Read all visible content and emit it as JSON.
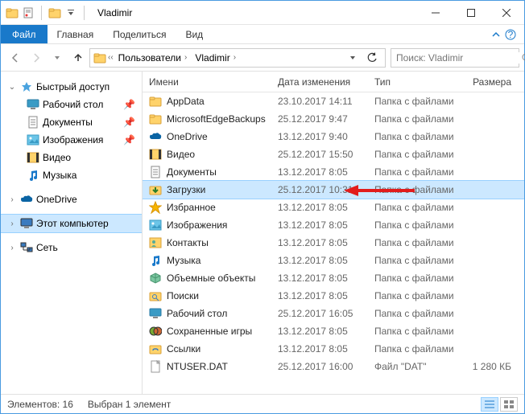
{
  "window": {
    "title": "Vladimir"
  },
  "ribbon": {
    "file": "Файл",
    "tabs": [
      "Главная",
      "Поделиться",
      "Вид"
    ]
  },
  "breadcrumbs": [
    "Пользователи",
    "Vladimir"
  ],
  "search": {
    "placeholder": "Поиск: Vladimir"
  },
  "nav": {
    "quick": {
      "label": "Быстрый доступ",
      "children": [
        {
          "label": "Рабочий стол",
          "icon": "desktop",
          "pin": true
        },
        {
          "label": "Документы",
          "icon": "documents",
          "pin": true
        },
        {
          "label": "Изображения",
          "icon": "pictures",
          "pin": true
        },
        {
          "label": "Видео",
          "icon": "videos",
          "pin": false
        },
        {
          "label": "Музыка",
          "icon": "music",
          "pin": false
        }
      ]
    },
    "onedrive": {
      "label": "OneDrive"
    },
    "thispc": {
      "label": "Этот компьютер"
    },
    "network": {
      "label": "Сеть"
    }
  },
  "columns": {
    "name": "Имени",
    "date": "Дата изменения",
    "type": "Тип",
    "size": "Размера"
  },
  "files": [
    {
      "name": "AppData",
      "date": "23.10.2017 14:11",
      "type": "Папка с файлами",
      "size": "",
      "icon": "folder"
    },
    {
      "name": "MicrosoftEdgeBackups",
      "date": "25.12.2017 9:47",
      "type": "Папка с файлами",
      "size": "",
      "icon": "folder"
    },
    {
      "name": "OneDrive",
      "date": "13.12.2017 9:40",
      "type": "Папка с файлами",
      "size": "",
      "icon": "onedrive"
    },
    {
      "name": "Видео",
      "date": "25.12.2017 15:50",
      "type": "Папка с файлами",
      "size": "",
      "icon": "videos"
    },
    {
      "name": "Документы",
      "date": "13.12.2017 8:05",
      "type": "Папка с файлами",
      "size": "",
      "icon": "documents"
    },
    {
      "name": "Загрузки",
      "date": "25.12.2017 10:31",
      "type": "Папка с файлами",
      "size": "",
      "icon": "downloads",
      "selected": true
    },
    {
      "name": "Избранное",
      "date": "13.12.2017 8:05",
      "type": "Папка с файлами",
      "size": "",
      "icon": "favorites"
    },
    {
      "name": "Изображения",
      "date": "13.12.2017 8:05",
      "type": "Папка с файлами",
      "size": "",
      "icon": "pictures"
    },
    {
      "name": "Контакты",
      "date": "13.12.2017 8:05",
      "type": "Папка с файлами",
      "size": "",
      "icon": "contacts"
    },
    {
      "name": "Музыка",
      "date": "13.12.2017 8:05",
      "type": "Папка с файлами",
      "size": "",
      "icon": "music"
    },
    {
      "name": "Объемные объекты",
      "date": "13.12.2017 8:05",
      "type": "Папка с файлами",
      "size": "",
      "icon": "3d"
    },
    {
      "name": "Поиски",
      "date": "13.12.2017 8:05",
      "type": "Папка с файлами",
      "size": "",
      "icon": "searches"
    },
    {
      "name": "Рабочий стол",
      "date": "25.12.2017 16:05",
      "type": "Папка с файлами",
      "size": "",
      "icon": "desktop"
    },
    {
      "name": "Сохраненные игры",
      "date": "13.12.2017 8:05",
      "type": "Папка с файлами",
      "size": "",
      "icon": "games"
    },
    {
      "name": "Ссылки",
      "date": "13.12.2017 8:05",
      "type": "Папка с файлами",
      "size": "",
      "icon": "links"
    },
    {
      "name": "NTUSER.DAT",
      "date": "25.12.2017 16:00",
      "type": "Файл \"DAT\"",
      "size": "1 280 КБ",
      "icon": "file"
    }
  ],
  "status": {
    "count": "Элементов: 16",
    "selection": "Выбран 1 элемент"
  }
}
